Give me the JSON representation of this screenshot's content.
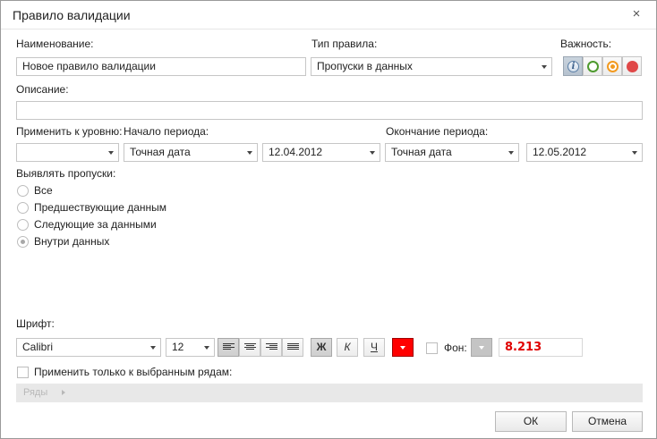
{
  "dialog": {
    "title": "Правило валидации",
    "close_glyph": "×"
  },
  "name": {
    "label": "Наименование:",
    "value": "Новое правило валидации"
  },
  "rule_type": {
    "label": "Тип правила:",
    "value": "Пропуски в данных"
  },
  "importance": {
    "label": "Важность:",
    "options": [
      {
        "name": "info",
        "glyph": "i",
        "color": "#5b7fa6",
        "selected": true
      },
      {
        "name": "low",
        "color": "#4e9a2e",
        "selected": false
      },
      {
        "name": "medium",
        "color": "#f29a1f",
        "selected": false
      },
      {
        "name": "high",
        "color": "#e04848",
        "selected": false
      }
    ]
  },
  "description": {
    "label": "Описание:",
    "value": ""
  },
  "apply_level": {
    "label": "Применить к уровню:",
    "value": ""
  },
  "period_start": {
    "label": "Начало периода:",
    "type_value": "Точная дата",
    "date_value": "12.04.2012"
  },
  "period_end": {
    "label": "Окончание периода:",
    "type_value": "Точная дата",
    "date_value": "12.05.2012"
  },
  "detect_gaps": {
    "label": "Выявлять пропуски:",
    "options": [
      {
        "label": "Все",
        "checked": false
      },
      {
        "label": "Предшествующие данным",
        "checked": false
      },
      {
        "label": "Следующие за данными",
        "checked": false
      },
      {
        "label": "Внутри данных",
        "checked": true
      }
    ]
  },
  "font": {
    "label": "Шрифт:",
    "family": "Calibri",
    "size": "12",
    "bold_label": "Ж",
    "italic_label": "К",
    "underline_label": "Ч",
    "text_color": "#ff0000",
    "background_label": "Фон:",
    "preview_value": "8.213"
  },
  "selected_rows": {
    "label": "Применить только к выбранным рядам:",
    "rows_label": "Ряды"
  },
  "buttons": {
    "ok": "ОК",
    "cancel": "Отмена"
  }
}
